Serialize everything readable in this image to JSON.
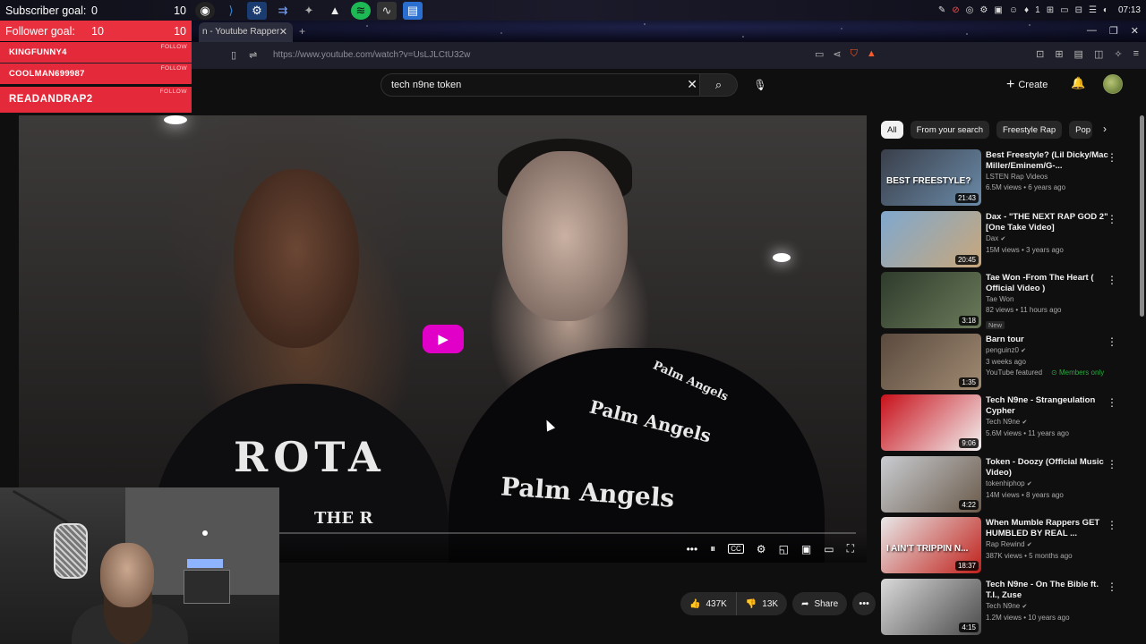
{
  "overlay": {
    "subscriber_goal": {
      "label": "Subscriber goal:",
      "current": "0",
      "target": "10"
    },
    "follower_goal": {
      "label": "Follower goal:",
      "current": "10",
      "target": "10"
    },
    "recent_followers": [
      {
        "name": "KINGFUNNY4",
        "tag": "FOLLOW"
      },
      {
        "name": "COOLMAN699987",
        "tag": "FOLLOW"
      },
      {
        "name": "READANDRAP2",
        "tag": "FOLLOW"
      }
    ]
  },
  "taskbar": {
    "apps": [
      "obs-icon",
      "vscode-icon",
      "steam-icon",
      "powerautomate-icon",
      "app-icon",
      "inkscape-icon",
      "spotify-icon",
      "monitor-icon",
      "docs-icon"
    ],
    "tray_count": "1",
    "clock": "07:13"
  },
  "browser": {
    "tab_title": "n - Youtube Rapper",
    "url": "https://www.youtube.com/watch?v=UsLJLCtU32w"
  },
  "youtube": {
    "search_query": "tech n9ne token",
    "create_label": "Create"
  },
  "video": {
    "shirt_left_top": "ROTA",
    "shirt_left_bottom": "THE R",
    "shirt_right_big": "Palm Angels",
    "shirt_right_arm": "Palm Angels",
    "shirt_right_mid": "Palm Angels"
  },
  "actions": {
    "likes": "437K",
    "dislikes": "13K",
    "share_label": "Share"
  },
  "chips": [
    "All",
    "From your search",
    "Freestyle Rap",
    "Pop"
  ],
  "recommendations": [
    {
      "title": "Best Freestyle? (Lil Dicky/Mac Miller/Eminem/G-...",
      "channel": "LSTEN Rap Videos",
      "verified": false,
      "meta": "6.5M views • 6 years ago",
      "duration": "21:43",
      "thumb_text": "BEST FREESTYLE?",
      "thumb_colors": [
        "#3a3f4a",
        "#6a8aa8"
      ]
    },
    {
      "title": "Dax - \"THE NEXT RAP GOD 2\" [One Take Video]",
      "channel": "Dax",
      "verified": true,
      "meta": "15M views • 3 years ago",
      "duration": "20:45",
      "thumb_text": "",
      "thumb_colors": [
        "#7fa8cf",
        "#c9a77a"
      ]
    },
    {
      "title": "Tae Won -From The Heart ( Official Video )",
      "channel": "Tae Won",
      "verified": false,
      "meta": "82 views • 11 hours ago",
      "badge": "New",
      "duration": "3:18",
      "thumb_text": "",
      "thumb_colors": [
        "#2f3b2c",
        "#6b7b5a"
      ]
    },
    {
      "title": "Barn tour",
      "channel": "penguinz0",
      "verified": true,
      "meta": "3 weeks ago",
      "extra_left": "YouTube featured",
      "extra_right": "Members only",
      "duration": "1:35",
      "thumb_text": "",
      "thumb_colors": [
        "#5a4a3e",
        "#a08a72"
      ]
    },
    {
      "title": "Tech N9ne - Strangeulation Cypher",
      "channel": "Tech N9ne",
      "verified": true,
      "meta": "5.6M views • 11 years ago",
      "duration": "9:06",
      "thumb_text": "",
      "thumb_colors": [
        "#c8101a",
        "#f2f2f2"
      ]
    },
    {
      "title": "Token - Doozy (Official Music Video)",
      "channel": "tokenhiphop",
      "verified": true,
      "meta": "14M views • 8 years ago",
      "duration": "4:22",
      "thumb_text": "",
      "thumb_colors": [
        "#c9ccd1",
        "#6a5a4a"
      ]
    },
    {
      "title": "When Mumble Rappers GET HUMBLED BY REAL ...",
      "channel": "Rap Rewind",
      "verified": true,
      "meta": "387K views • 5 months ago",
      "duration": "18:37",
      "thumb_text": "I AIN'T TRIPPIN N...",
      "thumb_colors": [
        "#e8e8e8",
        "#c0201a"
      ]
    },
    {
      "title": "Tech N9ne - On The Bible ft. T.I., Zuse",
      "channel": "Tech N9ne",
      "verified": true,
      "meta": "1.2M views • 10 years ago",
      "duration": "4:15",
      "thumb_text": "",
      "thumb_colors": [
        "#d9d9d9",
        "#4a4a4a"
      ]
    }
  ]
}
